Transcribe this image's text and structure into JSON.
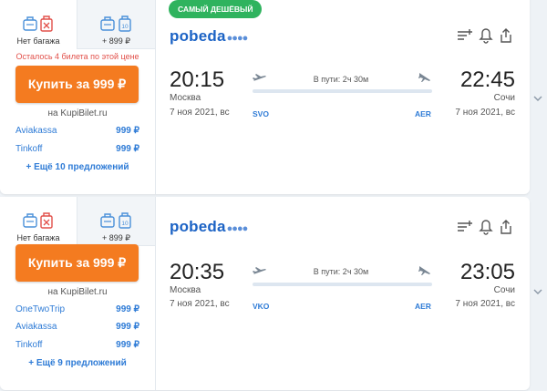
{
  "colors": {
    "accent": "#f47b20",
    "link": "#2e7bd6",
    "badge": "#2fb35e",
    "warn": "#e2504a"
  },
  "cards": [
    {
      "badge": "САМЫЙ ДЕШЁВЫЙ",
      "baggage": {
        "option1_label": "Нет багажа",
        "option2_label": "+ 899 ₽",
        "option2_kg": "10"
      },
      "warning": "Осталось 4 билета по этой цене",
      "buy_label": "Купить за 999 ₽",
      "seller_note": "на KupiBilet.ru",
      "agencies": [
        {
          "name": "Aviakassa",
          "price": "999 ₽"
        },
        {
          "name": "Tinkoff",
          "price": "999 ₽"
        }
      ],
      "more_label": "+ Ещё 10 предложений",
      "airline": "pobeda",
      "departure": {
        "time": "20:15",
        "city": "Москва",
        "date": "7 ноя 2021, вс",
        "code": "SVO"
      },
      "arrival": {
        "time": "22:45",
        "city": "Сочи",
        "date": "7 ноя 2021, вс",
        "code": "AER"
      },
      "duration": "В пути: 2ч 30м"
    },
    {
      "badge": "",
      "baggage": {
        "option1_label": "Нет багажа",
        "option2_label": "+ 899 ₽",
        "option2_kg": "10"
      },
      "warning": "",
      "buy_label": "Купить за 999 ₽",
      "seller_note": "на KupiBilet.ru",
      "agencies": [
        {
          "name": "OneTwoTrip",
          "price": "999 ₽"
        },
        {
          "name": "Aviakassa",
          "price": "999 ₽"
        },
        {
          "name": "Tinkoff",
          "price": "999 ₽"
        }
      ],
      "more_label": "+ Ещё 9 предложений",
      "airline": "pobeda",
      "departure": {
        "time": "20:35",
        "city": "Москва",
        "date": "7 ноя 2021, вс",
        "code": "VKO"
      },
      "arrival": {
        "time": "23:05",
        "city": "Сочи",
        "date": "7 ноя 2021, вс",
        "code": "AER"
      },
      "duration": "В пути: 2ч 30м"
    }
  ]
}
